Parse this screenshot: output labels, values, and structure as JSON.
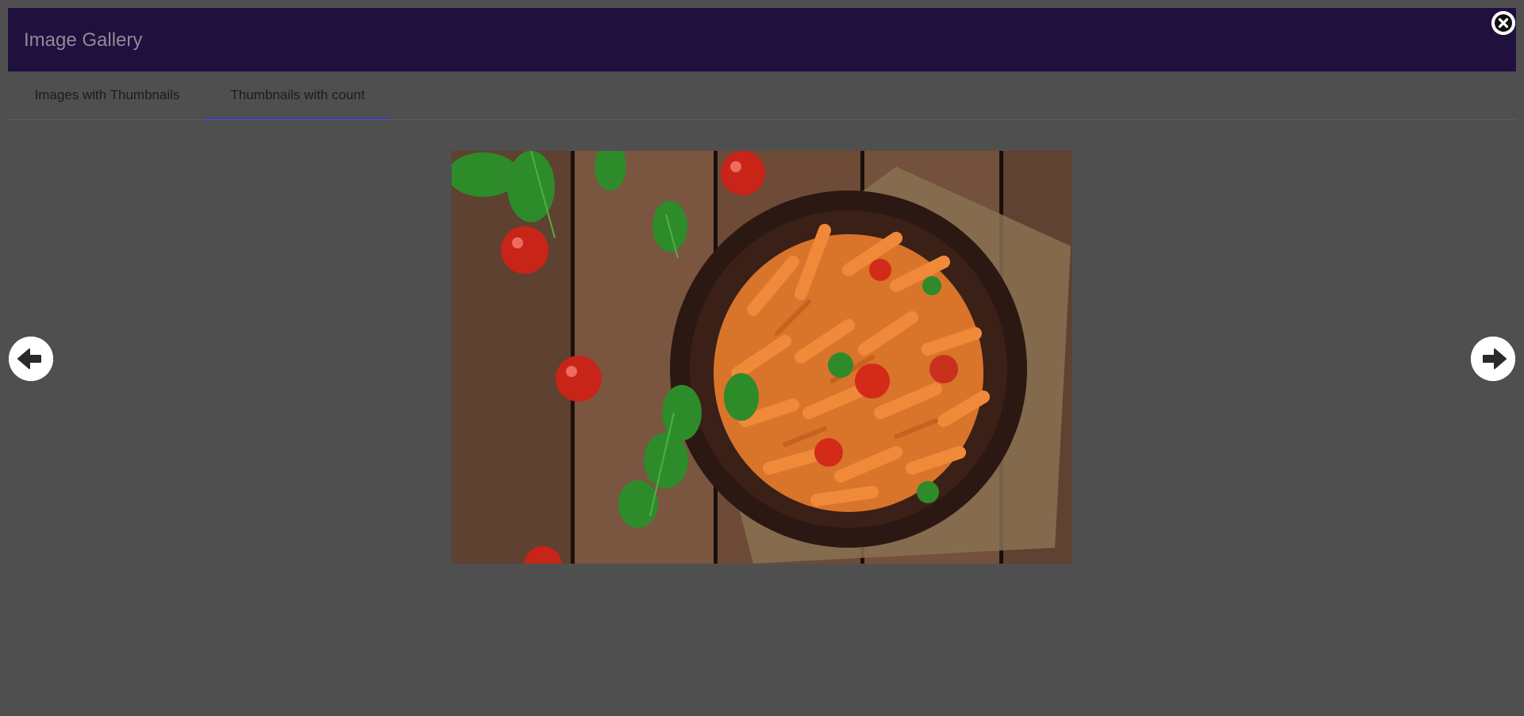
{
  "header": {
    "title": "Image Gallery",
    "close_icon": "close-icon",
    "background": "#20103e"
  },
  "tabs": [
    {
      "label": "Images with Thumbnails",
      "active": false
    },
    {
      "label": "Thumbnails with count",
      "active": true
    }
  ],
  "viewer": {
    "image_subject": "penne-pasta-with-tomato-sauce",
    "prev_icon": "arrow-left-icon",
    "next_icon": "arrow-right-icon"
  },
  "colors": {
    "overlay": "#4f4f4f",
    "active_tab_underline": "#3b3bc8",
    "header": "#20103e"
  }
}
